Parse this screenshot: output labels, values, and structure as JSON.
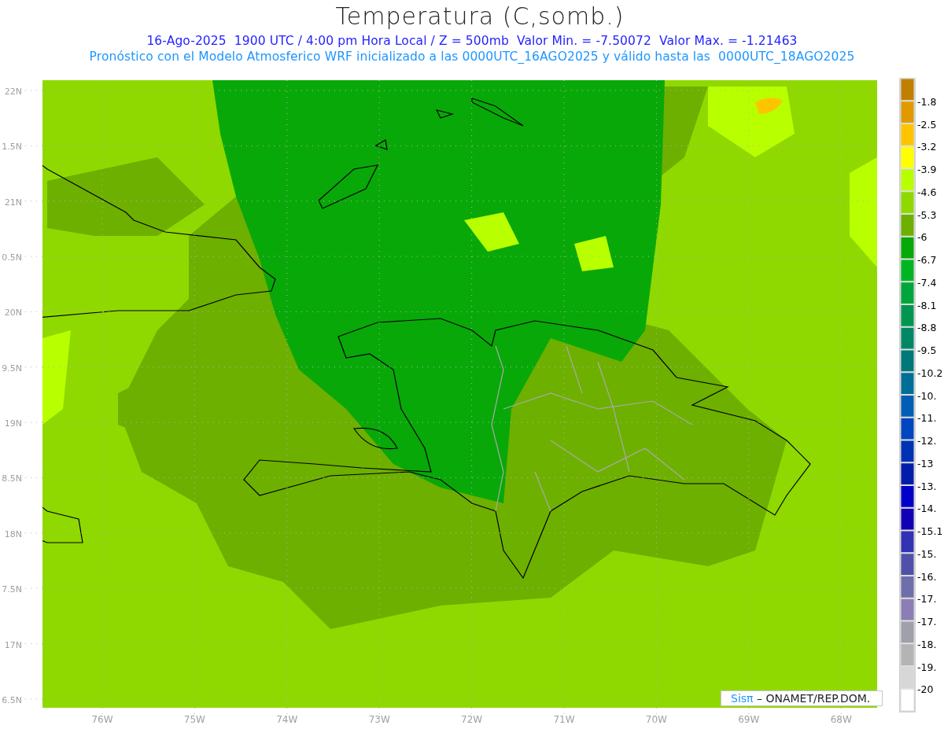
{
  "title": "Temperatura (C,somb.)",
  "subtitle_lines": [
    {
      "text": "16-Ago-2025  1900 UTC / 4:00 pm Hora Local / Z = 500mb  Valor Min. = -7.50072  Valor Max. = -1.21463",
      "color": "#2424ff"
    },
    {
      "text": "Pronóstico con el Modelo Atmosferico WRF inicializado a las 0000UTC_16AGO2025 y válido hasta las  0000UTC_18AGO2025",
      "color": "#1e96ff"
    }
  ],
  "y_axis_labels": [
    "22N",
    "1.5N",
    "21N",
    "0.5N",
    "20N",
    "9.5N",
    "19N",
    "8.5N",
    "18N",
    "7.5N",
    "17N",
    "6.5N"
  ],
  "x_axis_labels": [
    "76W",
    "75W",
    "74W",
    "73W",
    "72W",
    "71W",
    "70W",
    "69W",
    "68W"
  ],
  "colorbar": {
    "bins": [
      {
        "color": "#c07f00"
      },
      {
        "color": "#e09a00"
      },
      {
        "color": "#ffc400"
      },
      {
        "color": "#ffff00"
      },
      {
        "color": "#b8ff00"
      },
      {
        "color": "#8fd900"
      },
      {
        "color": "#6db000"
      },
      {
        "color": "#08a808"
      },
      {
        "color": "#00b521"
      },
      {
        "color": "#00a53c"
      },
      {
        "color": "#009650"
      },
      {
        "color": "#008764"
      },
      {
        "color": "#007878"
      },
      {
        "color": "#006e96"
      },
      {
        "color": "#005fb4"
      },
      {
        "color": "#0046be"
      },
      {
        "color": "#0032b4"
      },
      {
        "color": "#001eaa"
      },
      {
        "color": "#0000c8"
      },
      {
        "color": "#1400b4"
      },
      {
        "color": "#3232b4"
      },
      {
        "color": "#5050aa"
      },
      {
        "color": "#6e6eaa"
      },
      {
        "color": "#8c7db4"
      },
      {
        "color": "#a0a0aa"
      },
      {
        "color": "#b4b4b4"
      },
      {
        "color": "#d7d7d7"
      },
      {
        "color": "#ffffff"
      }
    ],
    "labels": [
      "-1.8",
      "-2.5",
      "-3.2",
      "-3.9",
      "-4.6",
      "-5.3",
      "-6",
      "-6.7",
      "-7.4",
      "-8.1",
      "-8.8",
      "-9.5",
      "-10.2",
      "-10.",
      "-11.",
      "-12.",
      "-13",
      "-13.",
      "-14.",
      "-15.1",
      "-15.",
      "-16.",
      "-17.",
      "-17.",
      "-18.",
      "-19.",
      "-20"
    ]
  },
  "credit": {
    "brand": "Sisπ",
    "text": "– ONAMET/REP.DOM."
  }
}
